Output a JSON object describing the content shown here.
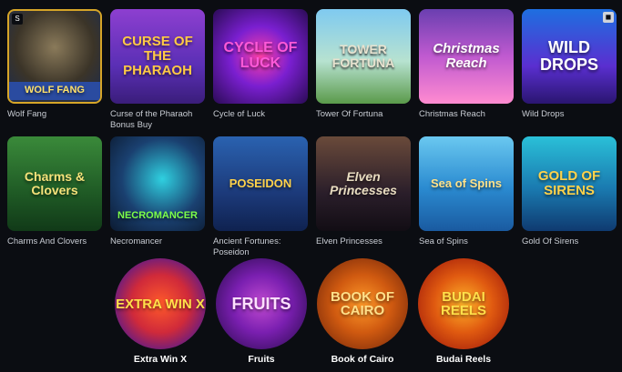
{
  "games_grid": [
    [
      {
        "title": "Wolf Fang",
        "art": "WOLF FANG",
        "style": "t-wolf",
        "icon": "wolf-icon"
      },
      {
        "title": "Curse of the Pharaoh Bonus Buy",
        "art": "CURSE OF THE PHARAOH",
        "style": "t-pharaoh",
        "icon": "pharaoh-icon"
      },
      {
        "title": "Cycle of Luck",
        "art": "CYCLE OF LUCK",
        "style": "t-cycle",
        "icon": "cycle-icon"
      },
      {
        "title": "Tower Of Fortuna",
        "art": "TOWER FORTUNA",
        "style": "t-tower",
        "icon": "tower-icon"
      },
      {
        "title": "Christmas Reach",
        "art": "Christmas Reach",
        "style": "t-christmas",
        "icon": "christmas-icon"
      },
      {
        "title": "Wild Drops",
        "art": "WILD DROPS",
        "style": "t-wild",
        "icon": "wild-drops-icon"
      }
    ],
    [
      {
        "title": "Charms And Clovers",
        "art": "Charms & Clovers",
        "style": "t-charms",
        "icon": "clover-icon"
      },
      {
        "title": "Necromancer",
        "art": "NECROMANCER",
        "style": "t-necro",
        "icon": "necromancer-icon"
      },
      {
        "title": "Ancient Fortunes: Poseidon",
        "art": "POSEIDON",
        "style": "t-poseidon",
        "icon": "poseidon-icon"
      },
      {
        "title": "Elven Princesses",
        "art": "Elven Princesses",
        "style": "t-elven",
        "icon": "elven-icon"
      },
      {
        "title": "Sea of Spins",
        "art": "Sea of Spins",
        "style": "t-sea",
        "icon": "sea-icon"
      },
      {
        "title": "Gold Of Sirens",
        "art": "GOLD OF SIRENS",
        "style": "t-gold",
        "icon": "sirens-icon"
      }
    ]
  ],
  "featured": [
    {
      "title": "Extra Win X",
      "art": "EXTRA WIN X",
      "style": "c-extra",
      "icon": "extra-win-icon"
    },
    {
      "title": "Fruits",
      "art": "FRUITS",
      "style": "c-fruits",
      "icon": "fruits-icon"
    },
    {
      "title": "Book of Cairo",
      "art": "BOOK OF CAIRO",
      "style": "c-book",
      "icon": "book-icon"
    },
    {
      "title": "Budai Reels",
      "art": "BUDAI REELS",
      "style": "c-budai",
      "icon": "budai-icon"
    }
  ]
}
